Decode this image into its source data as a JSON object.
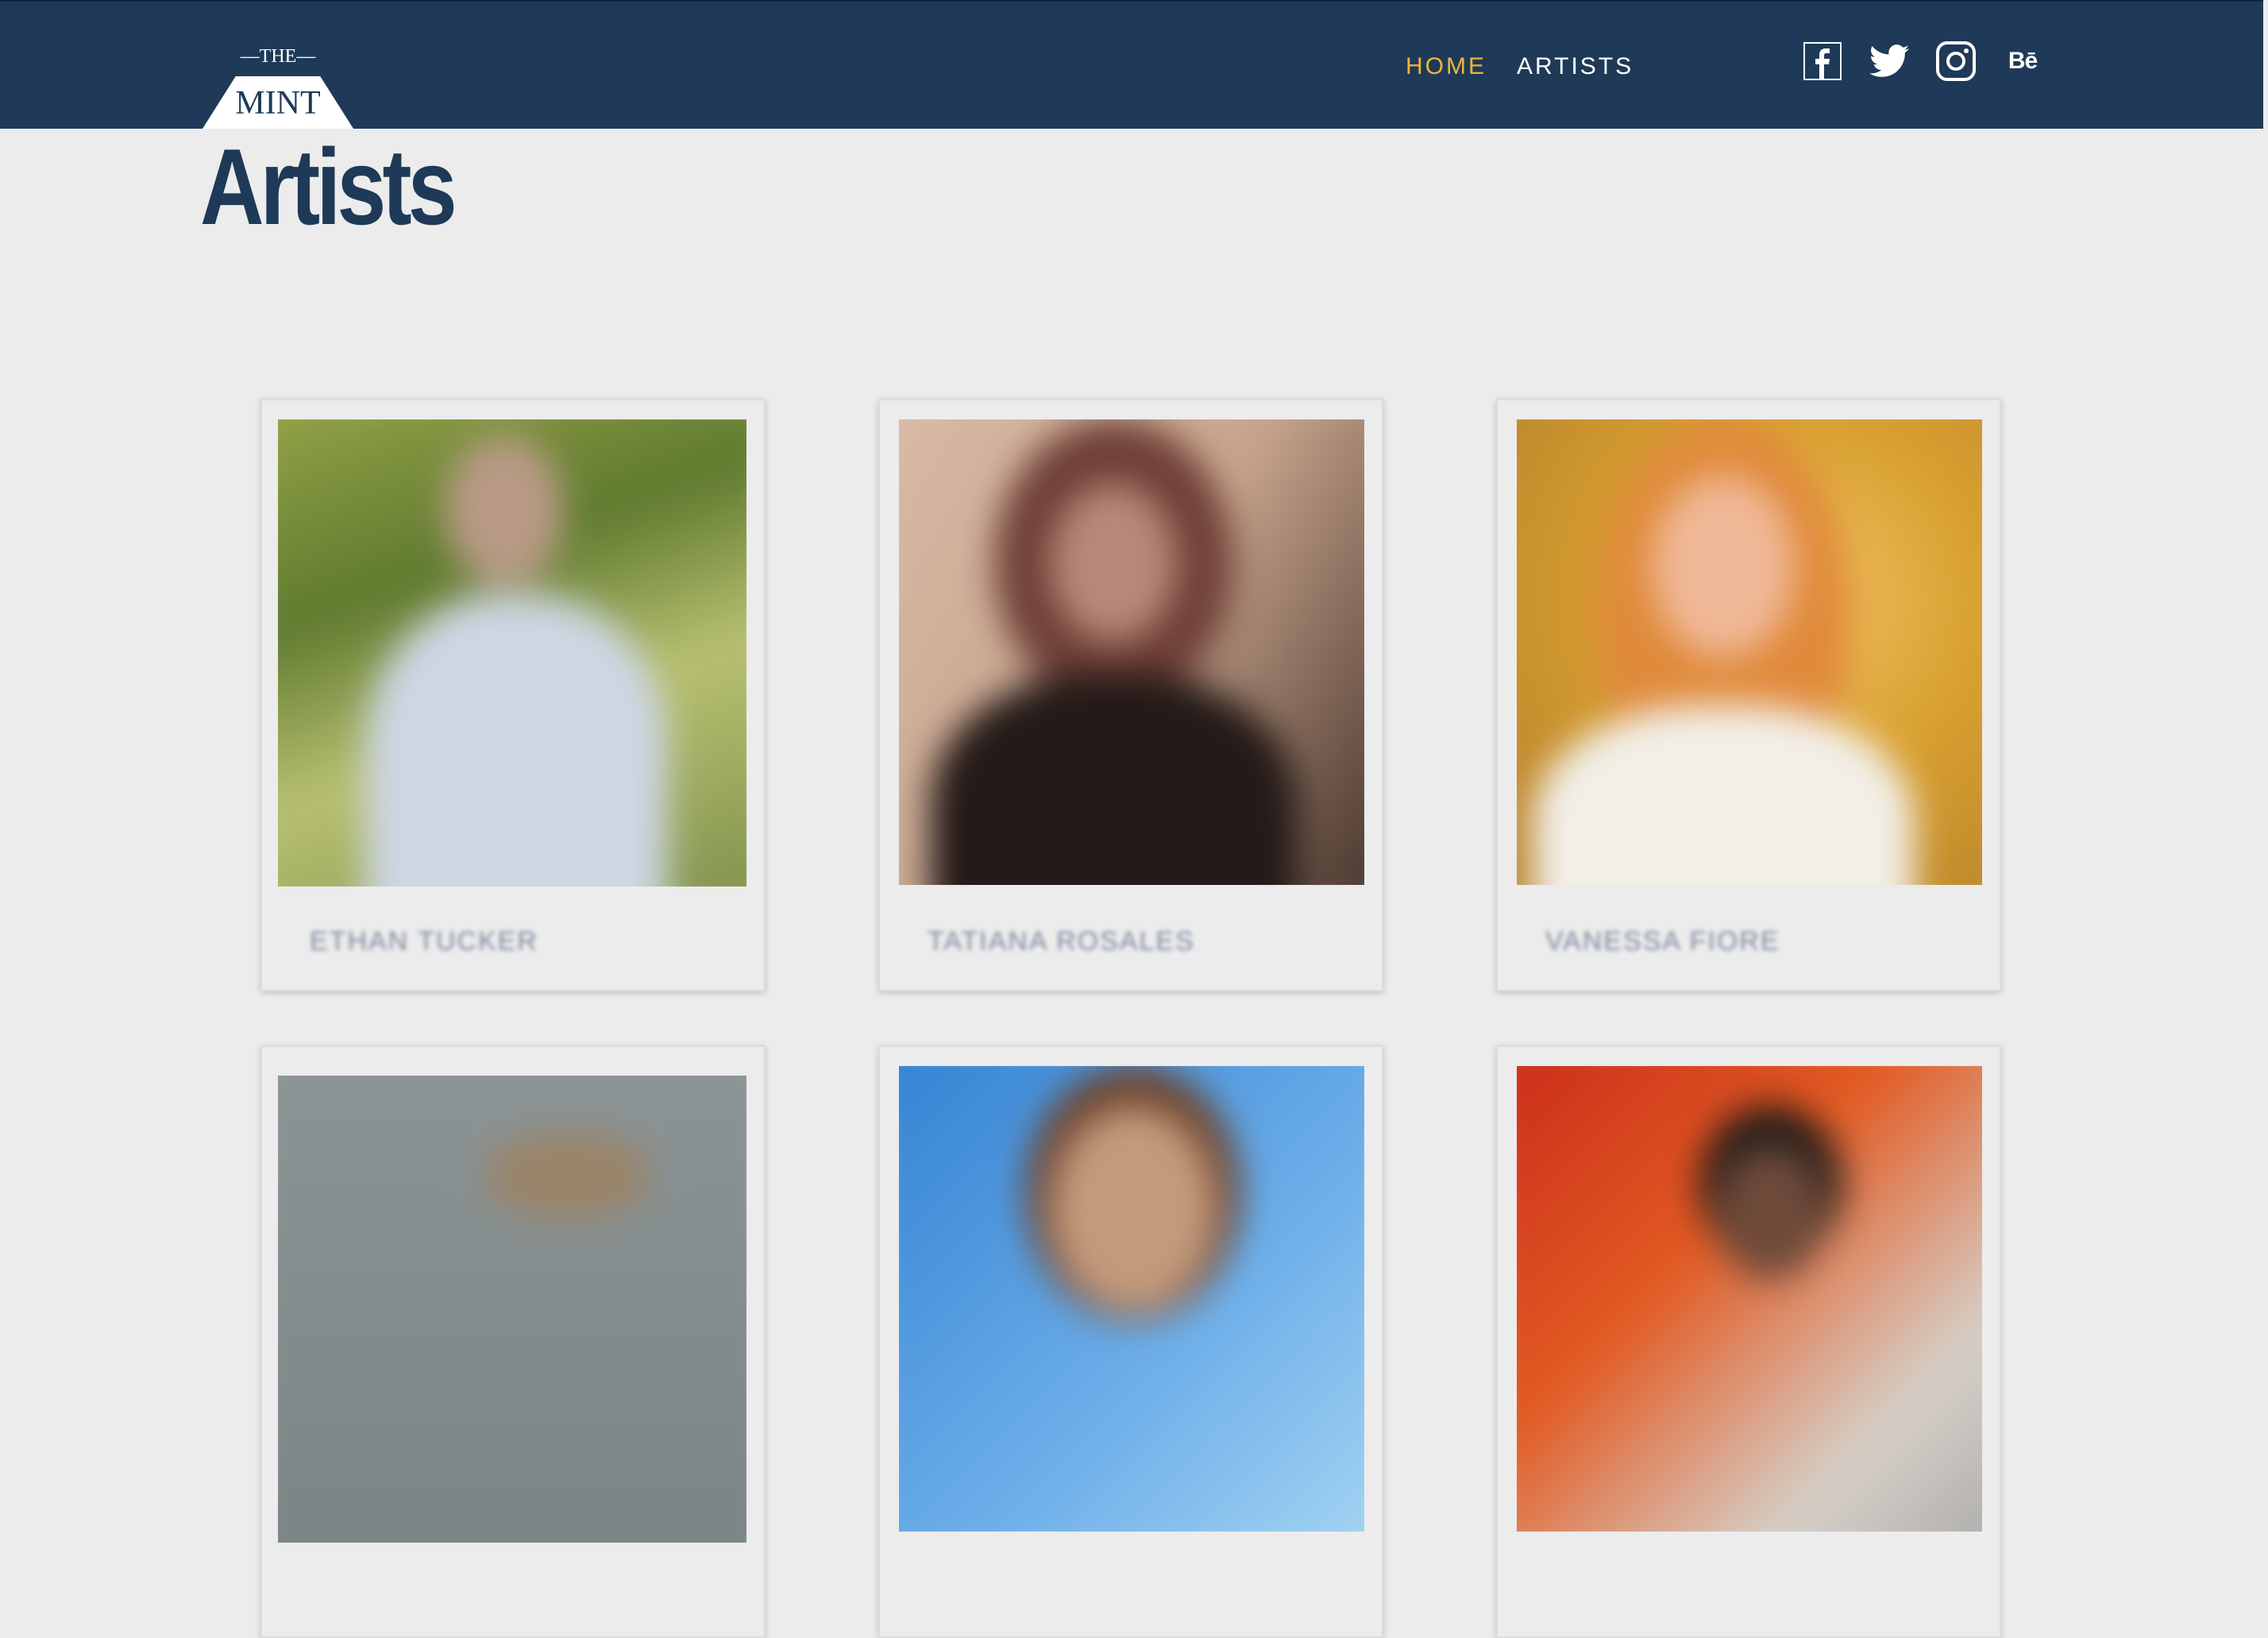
{
  "header": {
    "logo": {
      "top": "—THE—",
      "main": "MINT"
    },
    "nav": [
      {
        "label": "HOME",
        "active": true
      },
      {
        "label": "ARTISTS",
        "active": false
      }
    ],
    "social": [
      "facebook-icon",
      "twitter-icon",
      "instagram-icon",
      "behance-icon"
    ],
    "behance_glyph": "Bē"
  },
  "page": {
    "title": "Artists"
  },
  "artists": [
    {
      "name": "ETHAN TUCKER"
    },
    {
      "name": "TATIANA ROSALES"
    },
    {
      "name": "VANESSA FIORE"
    },
    {
      "name": ""
    },
    {
      "name": ""
    },
    {
      "name": ""
    }
  ],
  "colors": {
    "header_bg": "#1e3a58",
    "accent": "#f1b43c",
    "page_bg": "#ececec",
    "title": "#1e3a58"
  }
}
